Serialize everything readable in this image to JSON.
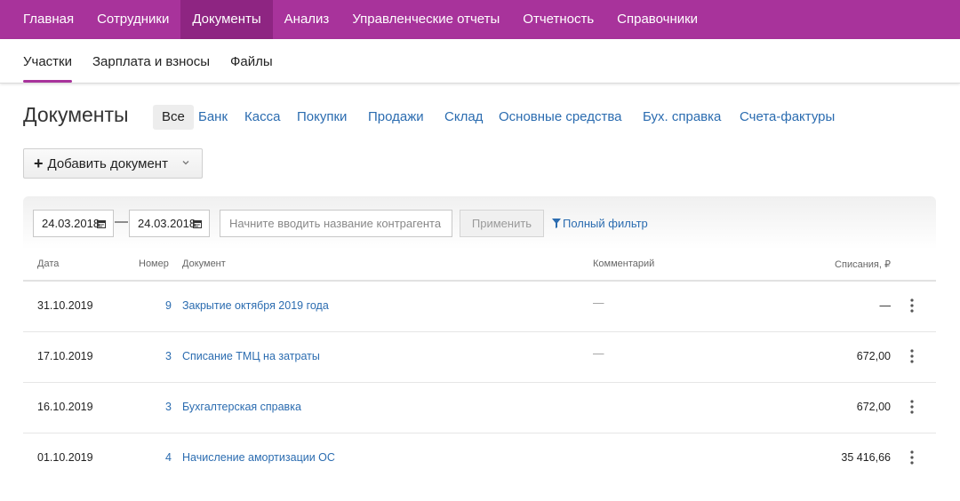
{
  "top_nav": {
    "items": [
      {
        "label": "Главная"
      },
      {
        "label": "Сотрудники"
      },
      {
        "label": "Документы",
        "active": true
      },
      {
        "label": "Анализ"
      },
      {
        "label": "Управленческие отчеты"
      },
      {
        "label": "Отчетность"
      },
      {
        "label": "Справочники"
      }
    ]
  },
  "sub_nav": {
    "items": [
      {
        "label": "Участки",
        "active": true
      },
      {
        "label": "Зарплата и взносы"
      },
      {
        "label": "Файлы"
      }
    ]
  },
  "page": {
    "title": "Документы"
  },
  "filter_tabs": [
    {
      "label": "Все",
      "active": true
    },
    {
      "label": "Банк"
    },
    {
      "label": "Касса"
    },
    {
      "label": "Покупки"
    },
    {
      "label": "Продажи"
    },
    {
      "label": "Склад"
    },
    {
      "label": "Основные средства"
    },
    {
      "label": "Бух. справка"
    },
    {
      "label": "Счета-фактуры"
    }
  ],
  "add_button": {
    "label": "Добавить документ",
    "icon": "plus-icon",
    "dropdown_icon": "chevron-down-icon"
  },
  "filter": {
    "date_from": "24.03.2018",
    "date_to": "24.03.2018",
    "separator": "—",
    "contragent_placeholder": "Начните вводить название контрагента",
    "apply_label": "Применить",
    "full_filter_label": "Полный фильтр",
    "calendar_icon": "calendar-icon",
    "filter_icon": "funnel-icon"
  },
  "table": {
    "columns": {
      "date": "Дата",
      "number": "Номер",
      "document": "Документ",
      "comment": "Комментарий",
      "amount": "Списания, ₽"
    },
    "rows": [
      {
        "date": "31.10.2019",
        "number": "9",
        "document": "Закрытие октября 2019 года",
        "comment": "—",
        "amount": "—"
      },
      {
        "date": "17.10.2019",
        "number": "3",
        "document": "Списание ТМЦ на затраты",
        "comment": "—",
        "amount": "672,00"
      },
      {
        "date": "16.10.2019",
        "number": "3",
        "document": "Бухгалтерская справка",
        "comment": "",
        "amount": "672,00"
      },
      {
        "date": "01.10.2019",
        "number": "4",
        "document": "Начисление амортизации ОС",
        "comment": "",
        "amount": "35 416,66"
      }
    ],
    "row_menu_icon": "more-vertical-icon"
  },
  "colors": {
    "brand": "#a8339b",
    "brand_active": "#8e2582",
    "link": "#2b6cb0"
  }
}
